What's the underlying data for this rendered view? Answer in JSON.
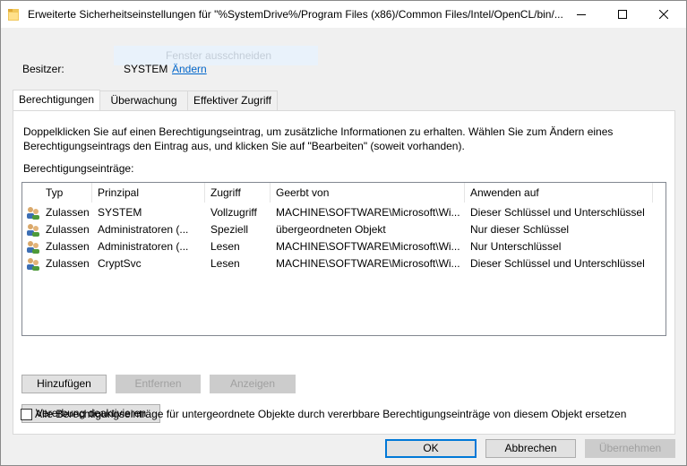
{
  "window": {
    "title": "Erweiterte Sicherheitseinstellungen für \"%SystemDrive%/Program Files (x86)/Common Files/Intel/OpenCL/bin/..."
  },
  "owner": {
    "label": "Besitzer:",
    "value": "SYSTEM",
    "change_link": "Ändern",
    "ghost_overlay_text": "Fenster ausschneiden"
  },
  "tabs": [
    {
      "label": "Berechtigungen",
      "active": true
    },
    {
      "label": "Überwachung",
      "active": false
    },
    {
      "label": "Effektiver Zugriff",
      "active": false
    }
  ],
  "panel": {
    "description": "Doppelklicken Sie auf einen Berechtigungseintrag, um zusätzliche Informationen zu erhalten. Wählen Sie zum Ändern eines Berechtigungseintrags den Eintrag aus, und klicken Sie auf \"Bearbeiten\" (soweit vorhanden).",
    "description_line1": "Doppelklicken Sie auf einen Berechtigungseintrag, um zusätzliche Informationen zu erhalten. Wählen Sie zum Ändern eines",
    "description_line2": "Berechtigungseintrags den Eintrag aus, und klicken Sie auf \"Bearbeiten\" (soweit vorhanden).",
    "entries_label": "Berechtigungseinträge:"
  },
  "table": {
    "columns": [
      "Typ",
      "Prinzipal",
      "Zugriff",
      "Geerbt von",
      "Anwenden auf"
    ],
    "rows": [
      {
        "icon": "users-icon",
        "type": "Zulassen",
        "principal": "SYSTEM",
        "access": "Vollzugriff",
        "inherited_from": "MACHINE\\SOFTWARE\\Microsoft\\Wi...",
        "applies_to": "Dieser Schlüssel und Unterschlüssel"
      },
      {
        "icon": "users-icon",
        "type": "Zulassen",
        "principal": "Administratoren (...",
        "access": "Speziell",
        "inherited_from": "übergeordneten Objekt",
        "applies_to": "Nur dieser Schlüssel"
      },
      {
        "icon": "users-icon",
        "type": "Zulassen",
        "principal": "Administratoren (...",
        "access": "Lesen",
        "inherited_from": "MACHINE\\SOFTWARE\\Microsoft\\Wi...",
        "applies_to": "Nur Unterschlüssel"
      },
      {
        "icon": "users-icon",
        "type": "Zulassen",
        "principal": "CryptSvc",
        "access": "Lesen",
        "inherited_from": "MACHINE\\SOFTWARE\\Microsoft\\Wi...",
        "applies_to": "Dieser Schlüssel und Unterschlüssel"
      }
    ]
  },
  "buttons": {
    "add": "Hinzufügen",
    "remove": "Entfernen",
    "view": "Anzeigen",
    "disable_inheritance": "Vererbung deaktivieren",
    "ok": "OK",
    "cancel": "Abbrechen",
    "apply": "Übernehmen"
  },
  "checkbox": {
    "label": "Alle Berechtigungseinträge für untergeordnete Objekte durch vererbbare Berechtigungseinträge von diesem Objekt ersetzen",
    "checked": false
  },
  "colors": {
    "accent": "#0078d7",
    "link": "#0066cc",
    "disabled_text": "#a0a0a0"
  }
}
